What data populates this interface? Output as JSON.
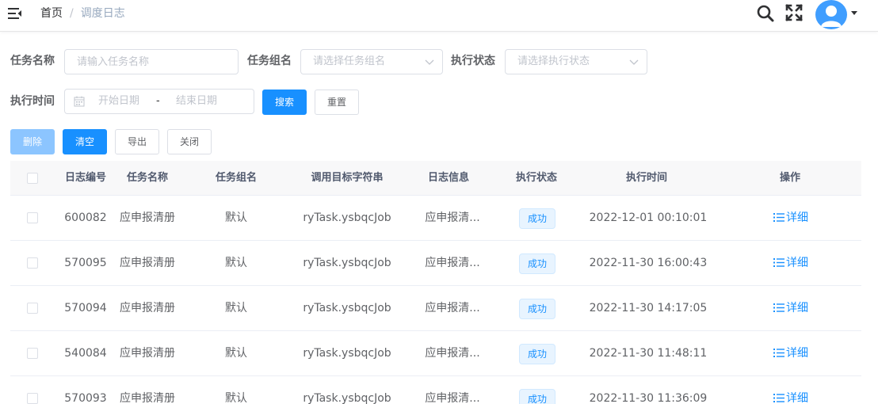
{
  "breadcrumb": {
    "home": "首页",
    "separator": "/",
    "current": "调度日志"
  },
  "header": {
    "icons": [
      "hamburger-icon",
      "search-icon",
      "fullscreen-icon",
      "user-avatar",
      "caret-down-icon"
    ]
  },
  "colors": {
    "primary": "#1890ff",
    "primary_disabled": "#8cc5ff",
    "tag_bg": "#e8f4ff"
  },
  "form": {
    "job_name": {
      "label": "任务名称",
      "placeholder": "请输入任务名称"
    },
    "job_group": {
      "label": "任务组名",
      "placeholder": "请选择任务组名"
    },
    "status": {
      "label": "执行状态",
      "placeholder": "请选择执行状态"
    },
    "time": {
      "label": "执行时间",
      "start_placeholder": "开始日期",
      "separator": "-",
      "end_placeholder": "结束日期"
    },
    "search_label": "搜索",
    "reset_label": "重置"
  },
  "toolbar": {
    "delete_label": "删除",
    "clean_label": "清空",
    "export_label": "导出",
    "close_label": "关闭"
  },
  "table": {
    "columns": [
      "日志编号",
      "任务名称",
      "任务组名",
      "调用目标字符串",
      "日志信息",
      "执行状态",
      "执行时间",
      "操作"
    ],
    "rows": [
      {
        "id": "600082",
        "name": "应申报清册",
        "group": "默认",
        "target": "ryTask.ysbqcJob",
        "message": "应申报清...",
        "status": "成功",
        "time": "2022-12-01 00:10:01",
        "action": "详细"
      },
      {
        "id": "570095",
        "name": "应申报清册",
        "group": "默认",
        "target": "ryTask.ysbqcJob",
        "message": "应申报清...",
        "status": "成功",
        "time": "2022-11-30 16:00:43",
        "action": "详细"
      },
      {
        "id": "570094",
        "name": "应申报清册",
        "group": "默认",
        "target": "ryTask.ysbqcJob",
        "message": "应申报清...",
        "status": "成功",
        "time": "2022-11-30 14:17:05",
        "action": "详细"
      },
      {
        "id": "540084",
        "name": "应申报清册",
        "group": "默认",
        "target": "ryTask.ysbqcJob",
        "message": "应申报清...",
        "status": "成功",
        "time": "2022-11-30 11:48:11",
        "action": "详细"
      },
      {
        "id": "570093",
        "name": "应申报清册",
        "group": "默认",
        "target": "ryTask.ysbqcJob",
        "message": "应申报清...",
        "status": "成功",
        "time": "2022-11-30 11:36:09",
        "action": "详细"
      }
    ]
  }
}
